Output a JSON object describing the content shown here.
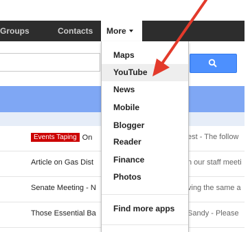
{
  "nav": {
    "groups": "Groups",
    "contacts": "Contacts",
    "more": "More"
  },
  "search": {
    "button_icon": "search-icon"
  },
  "menu": {
    "items": [
      "Maps",
      "YouTube",
      "News",
      "Mobile",
      "Blogger",
      "Reader",
      "Finance",
      "Photos"
    ],
    "find_more": "Find more apps",
    "hovered": "YouTube"
  },
  "rows": [
    {
      "badge": "Events Taping",
      "left": "On",
      "right": "est - The follow"
    },
    {
      "left": "Article on Gas Dist",
      "right": "n our staff meeti"
    },
    {
      "left": "Senate Meeting - N",
      "right": "ving the same a"
    },
    {
      "left": "Those Essential Ba",
      "right": "Sandy - Please"
    }
  ],
  "colors": {
    "navbar": "#2d2d2d",
    "blue_band": "#7fa7f4",
    "search_button": "#4d90fe",
    "badge": "#cc0000",
    "arrow": "#e33a2b"
  }
}
